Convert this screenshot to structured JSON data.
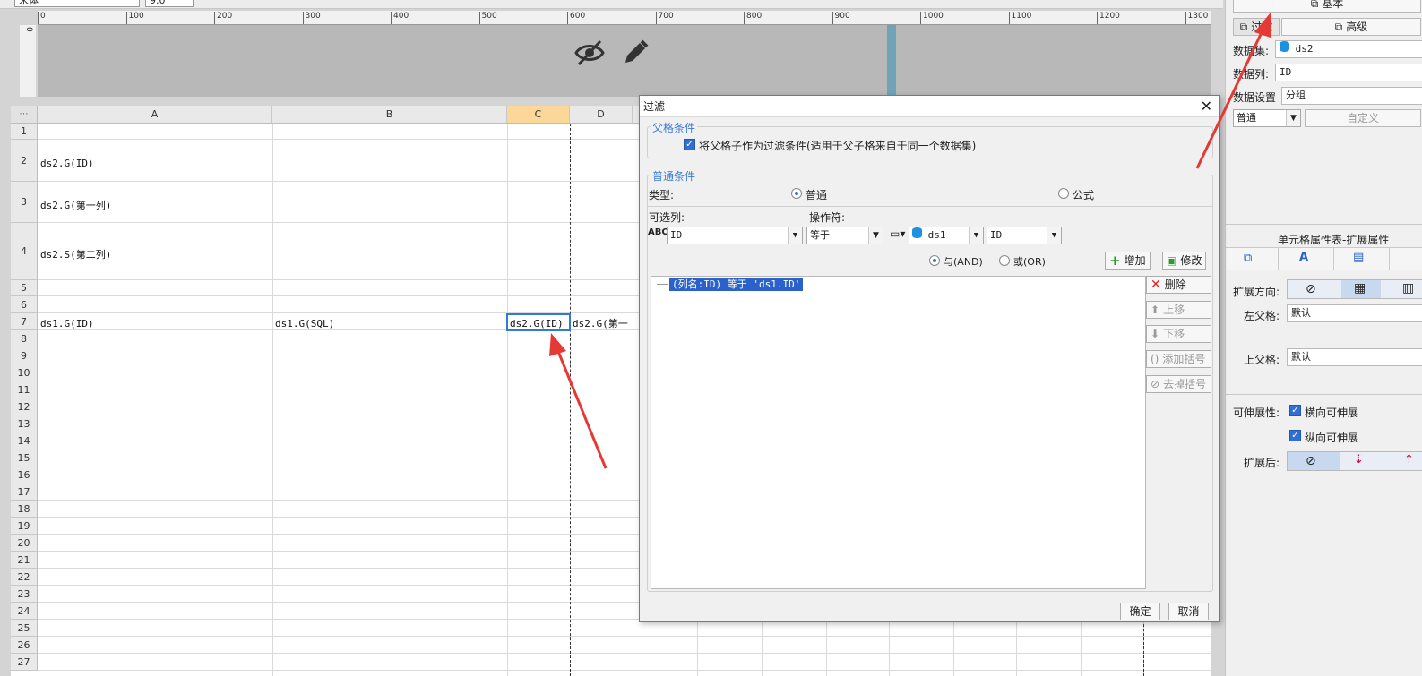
{
  "toolbar": {
    "font_name": "宋体",
    "font_size": "9.0"
  },
  "ruler": {
    "ticks": [
      "0",
      "100",
      "200",
      "300",
      "400",
      "500",
      "600",
      "700",
      "800",
      "900",
      "1000",
      "1100",
      "1200",
      "1300"
    ]
  },
  "vruler": {
    "tick": "0"
  },
  "grid": {
    "columns": [
      "A",
      "B",
      "C",
      "D"
    ],
    "rows": [
      "1",
      "2",
      "3",
      "4",
      "5",
      "6",
      "7",
      "8",
      "9",
      "10",
      "11",
      "12",
      "13",
      "14",
      "15",
      "16",
      "17",
      "18",
      "19",
      "20",
      "21",
      "22",
      "23",
      "24",
      "25",
      "26",
      "27"
    ],
    "cells": {
      "a2": "ds2.G(ID)",
      "a3": "ds2.G(第一列)",
      "a4": "ds2.S(第二列)",
      "a7": "ds1.G(ID)",
      "b7": "ds1.G(SQL)",
      "c7": "ds2.G(ID)",
      "d7": "ds2.G(第一"
    }
  },
  "right_panel": {
    "tab_basic": "基本",
    "btn_filter": "过滤",
    "btn_advanced": "高级",
    "dataset_label": "数据集:",
    "dataset_value": "ds2",
    "datacol_label": "数据列:",
    "datacol_value": "ID",
    "datasetting_label": "数据设置",
    "datasetting_value": "分组",
    "mode_value": "普通",
    "custom_btn": "自定义",
    "ext_title": "单元格属性表-扩展属性",
    "expand_dir_label": "扩展方向:",
    "left_parent_label": "左父格:",
    "left_parent_value": "默认",
    "top_parent_label": "上父格:",
    "top_parent_value": "默认",
    "stretch_label": "可伸展性:",
    "stretch_h": "横向可伸展",
    "stretch_v": "纵向可伸展",
    "after_expand_label": "扩展后:"
  },
  "dialog": {
    "title": "过滤",
    "parent_group": "父格条件",
    "parent_checkbox": "将父格子作为过滤条件(适用于父子格来自于同一个数据集)",
    "normal_group": "普通条件",
    "type_label": "类型:",
    "type_normal": "普通",
    "type_formula": "公式",
    "col_label": "可选列:",
    "op_label": "操作符:",
    "col_value": "ID",
    "op_value": "等于",
    "ds_value": "ds1",
    "field_value": "ID",
    "and_label": "与(AND)",
    "or_label": "或(OR)",
    "add_btn": "增加",
    "modify_btn": "修改",
    "condition_text": "(列名:ID) 等于 'ds1.ID'",
    "delete_btn": "删除",
    "up_btn": "上移",
    "down_btn": "下移",
    "add_paren_btn": "添加括号",
    "remove_paren_btn": "去掉括号",
    "ok_btn": "确定",
    "cancel_btn": "取消"
  },
  "colors": {
    "accent": "#2f6fd6",
    "group_title": "#3a7bd5",
    "arrow": "#e53935",
    "selected_col": "#fbd89a"
  }
}
